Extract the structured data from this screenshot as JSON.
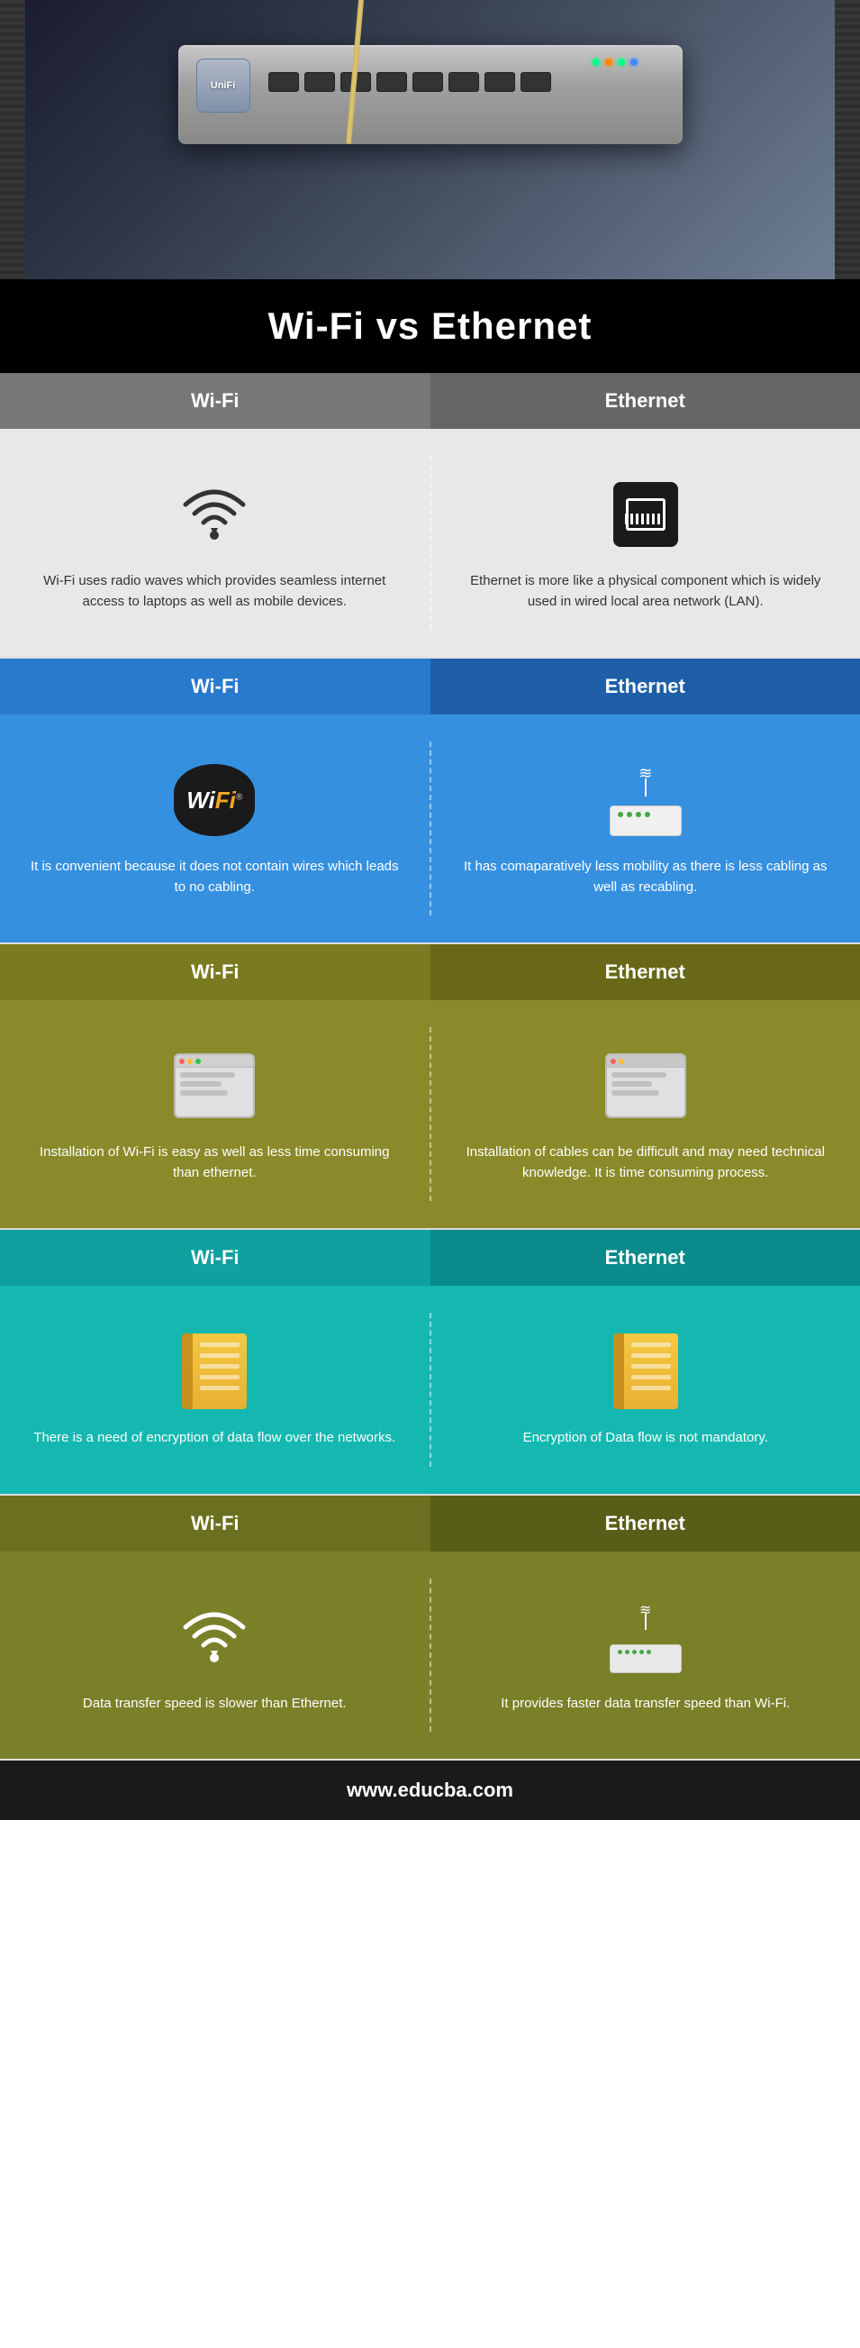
{
  "page": {
    "title": "Wi-Fi vs Ethernet",
    "footer": "www.educba.com"
  },
  "sections": [
    {
      "id": "intro",
      "header_wifi": "Wi-Fi",
      "header_ethernet": "Ethernet",
      "wifi_text": "Wi-Fi uses radio waves which provides seamless internet access to laptops as well as mobile devices.",
      "ethernet_text": "Ethernet is more like a physical component which is widely used in wired local area network (LAN).",
      "bg_header": "gray",
      "bg_content": "lightgray"
    },
    {
      "id": "mobility",
      "header_wifi": "Wi-Fi",
      "header_ethernet": "Ethernet",
      "wifi_text": "It is convenient because it does not contain wires which leads to no cabling.",
      "ethernet_text": "It has comaparatively less mobility as there is less cabling as well as recabling.",
      "bg": "blue"
    },
    {
      "id": "installation",
      "header_wifi": "Wi-Fi",
      "header_ethernet": "Ethernet",
      "wifi_text": "Installation of Wi-Fi is easy as well as less time consuming than ethernet.",
      "ethernet_text": "Installation of cables can be difficult and may need technical knowledge. It is time consuming process.",
      "bg": "olive"
    },
    {
      "id": "encryption",
      "header_wifi": "Wi-Fi",
      "header_ethernet": "Ethernet",
      "wifi_text": "There is a need of encryption of data flow over the networks.",
      "ethernet_text": "Encryption of Data flow is not mandatory.",
      "bg": "teal"
    },
    {
      "id": "speed",
      "header_wifi": "Wi-Fi",
      "header_ethernet": "Ethernet",
      "wifi_text": "Data transfer speed is slower than Ethernet.",
      "ethernet_text": "It provides faster data transfer speed than Wi-Fi.",
      "bg": "darkolive"
    }
  ]
}
